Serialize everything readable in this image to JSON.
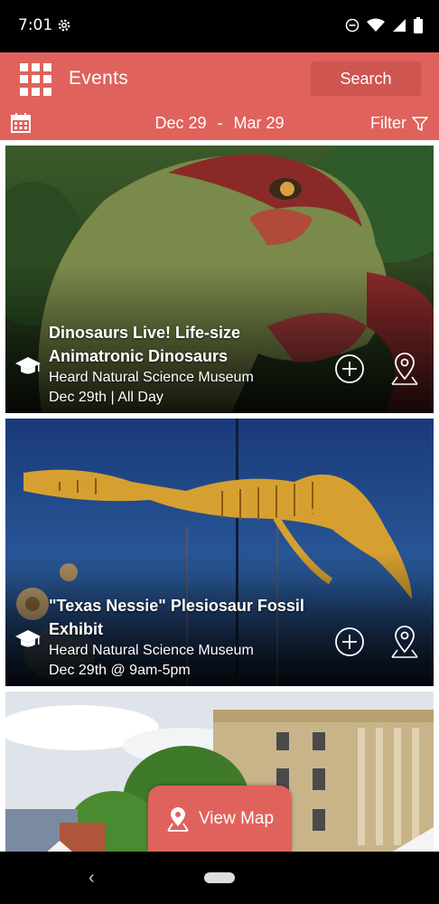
{
  "status": {
    "time": "7:01"
  },
  "app": {
    "title": "Events",
    "search_label": "Search"
  },
  "date_bar": {
    "start": "Dec 29",
    "separator": "-",
    "end": "Mar 29",
    "filter_label": "Filter"
  },
  "events": [
    {
      "title": "Dinosaurs Live! Life-size Animatronic Dinosaurs",
      "venue": "Heard Natural Science Museum",
      "date": "Dec 29th | All Day",
      "category_icon": "graduation-cap-icon"
    },
    {
      "title": "\"Texas Nessie\" Plesiosaur Fossil Exhibit",
      "venue": "Heard Natural Science Museum",
      "date": "Dec 29th @ 9am-5pm",
      "category_icon": "graduation-cap-icon"
    }
  ],
  "view_map_label": "View Map",
  "colors": {
    "accent": "#e0625c",
    "accent_dark": "#cf5551"
  }
}
